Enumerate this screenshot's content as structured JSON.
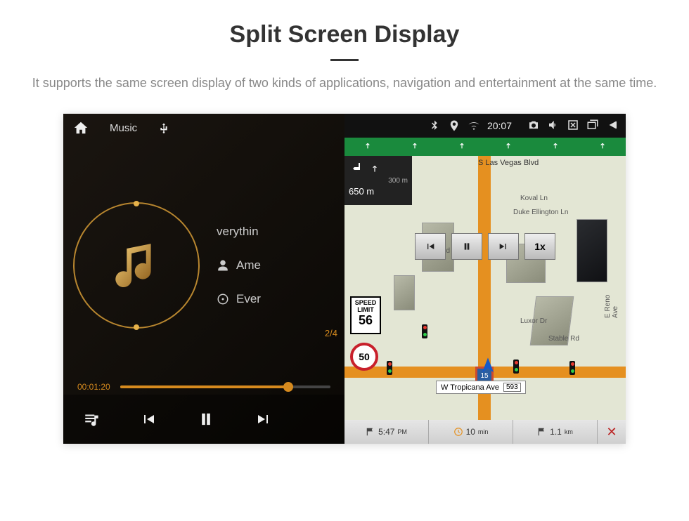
{
  "title": "Split Screen Display",
  "description": "It supports the same screen display of two kinds of applications, navigation and entertainment at the same time.",
  "music": {
    "app_label": "Music",
    "tracks": {
      "current": "verythin",
      "artist": "Ame",
      "album": "Ever"
    },
    "index": "2/4",
    "elapsed": "00:01:20"
  },
  "status": {
    "time": "20:07"
  },
  "nav": {
    "turn_small": "300 m",
    "turn_main": "650 m",
    "top_street": "S Las Vegas Blvd",
    "koval": "Koval Ln",
    "duke": "Duke Ellington Ln",
    "vegas_blvd": "Vegas Blvd",
    "luxor": "Luxor Dr",
    "stable": "Stable Rd",
    "reno": "E Reno Ave",
    "hwy_shield": "15",
    "speed_label1": "SPEED",
    "speed_label2": "LIMIT",
    "speed_limit_value": "56",
    "speed_current": "50",
    "tropicana": "W Tropicana Ave",
    "tropicana_badge": "593"
  },
  "media_overlay": {
    "speed_factor": "1x"
  },
  "bottom": {
    "eta": "5:47",
    "unit_pm": "PM",
    "remaining": "10",
    "remaining_unit": "min",
    "distance": "1.1",
    "distance_unit": "km"
  }
}
